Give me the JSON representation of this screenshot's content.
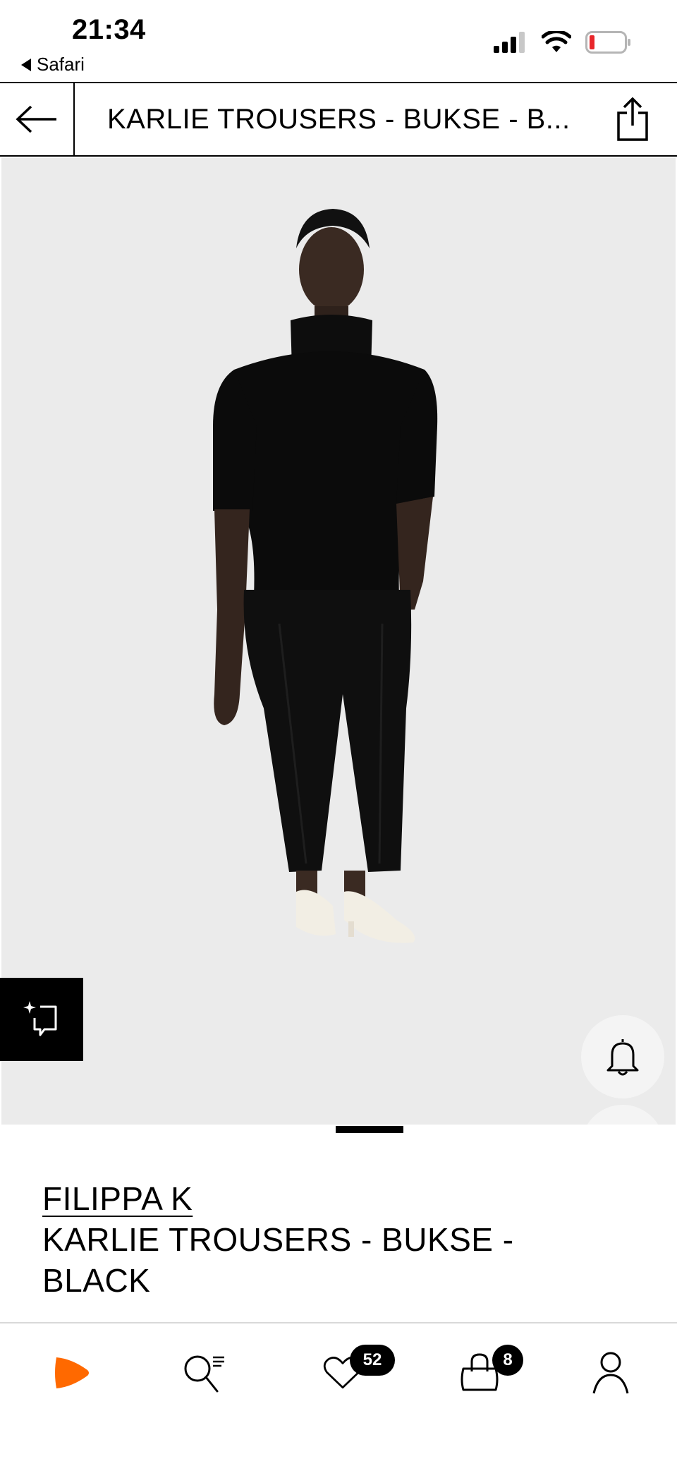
{
  "status_bar": {
    "time": "21:34",
    "back_app": "Safari"
  },
  "header": {
    "title": "KARLIE TROUSERS - BUKSE - B..."
  },
  "product": {
    "brand": "FILIPPA K",
    "name": "KARLIE TROUSERS - BUKSE - BLACK"
  },
  "gallery": {
    "image_count_shown": 1
  },
  "tabbar": {
    "wishlist_count": "52",
    "cart_count": "8"
  },
  "colors": {
    "accent": "#ff6900",
    "image_bg": "#ebebeb",
    "black": "#000000"
  },
  "icons": [
    "arrow-left-icon",
    "share-icon",
    "bell-icon",
    "heart-icon",
    "bag-icon",
    "sparkle-similar-icon",
    "zalando-play-icon",
    "search-list-icon",
    "cart-icon",
    "user-icon"
  ]
}
